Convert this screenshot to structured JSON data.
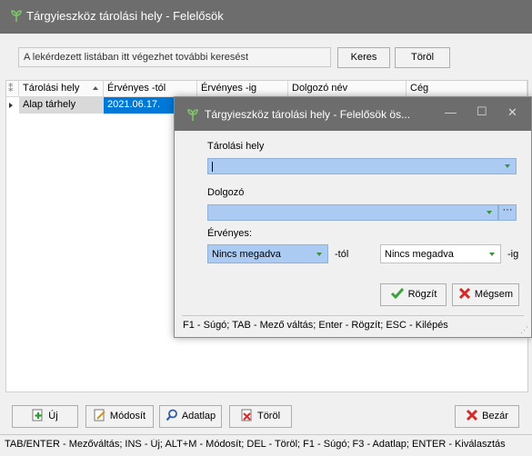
{
  "window": {
    "title": "Tárgyieszköz tárolási hely - Felelősök",
    "icon": "app-leaf-icon"
  },
  "search": {
    "placeholder": "A lekérdezett listában itt végezhet további keresést",
    "search_label": "Keres",
    "clear_label": "Töröl"
  },
  "grid": {
    "columns": [
      "Tárolási hely",
      "Érvényes -tól",
      "Érvényes -ig",
      "Dolgozó név",
      "Cég"
    ],
    "rows": [
      {
        "tarolasi_hely": "Alap tárhely",
        "ervenyes_tol": "2021.06.17."
      }
    ]
  },
  "dialog": {
    "title": "Tárgyieszköz tárolási hely - Felelősök ös...",
    "tarolasi_hely_label": "Tárolási hely",
    "tarolasi_hely_value": "",
    "dolgozo_label": "Dolgozó",
    "dolgozo_value": "",
    "ervenyes_label": "Érvényes:",
    "from_value": "Nincs megadva",
    "from_suffix": "-tól",
    "to_value": "Nincs megadva",
    "to_suffix": "-ig",
    "ok_label": "Rögzít",
    "cancel_label": "Mégsem",
    "status": "F1 - Súgó; TAB - Mező váltás; Enter - Rögzít; ESC - Kilépés"
  },
  "toolbar": {
    "new_label": "Új",
    "modify_label": "Módosít",
    "datasheet_label": "Adatlap",
    "delete_label": "Töröl",
    "close_label": "Bezár"
  },
  "status": "TAB/ENTER - Mezőváltás; INS - Új; ALT+M - Módosít; DEL - Töröl; F1 - Súgó; F3 - Adatlap; ENTER - Kiválasztás",
  "colors": {
    "titlebar": "#6d6d6d",
    "selection": "#0078d7",
    "combo_blue": "#abcbf3"
  }
}
